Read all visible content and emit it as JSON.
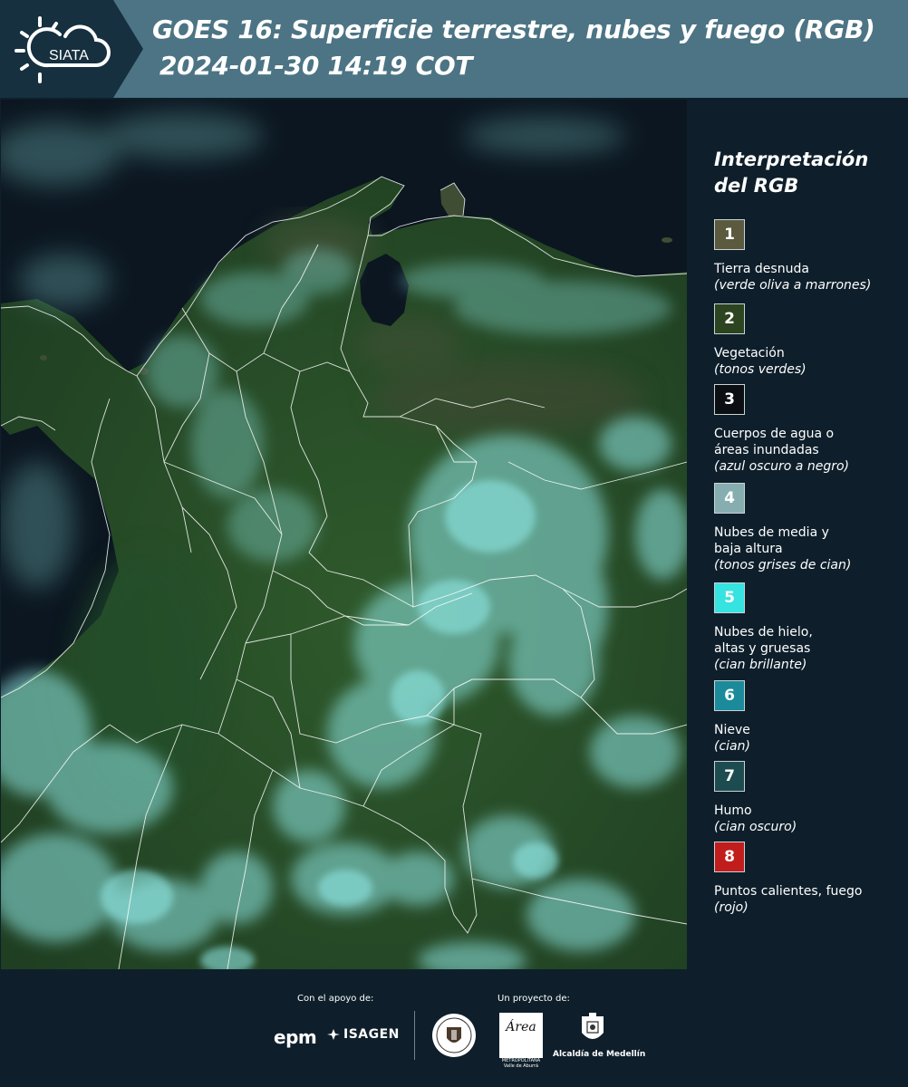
{
  "header": {
    "logo_text": "SIATA",
    "title_line1": "GOES 16: Superficie terrestre, nubes y fuego (RGB)",
    "title_line2": "2024-01-30 14:19 COT"
  },
  "legend": {
    "title": "Interpretación del RGB",
    "items": [
      {
        "number": "1",
        "name": "Tierra desnuda",
        "desc": "(verde oliva a marrones)",
        "color": "#5b5a3f",
        "text_color": "#ffffff"
      },
      {
        "number": "2",
        "name": "Vegetación",
        "desc": "(tonos verdes)",
        "color": "#2d4420",
        "text_color": "#ffffff"
      },
      {
        "number": "3",
        "name": "Cuerpos de agua o áreas inundadas",
        "desc": "(azul oscuro a negro)",
        "color": "#0b0f14",
        "text_color": "#ffffff"
      },
      {
        "number": "4",
        "name": "Nubes de media y baja altura",
        "desc": "(tonos grises de cian)",
        "color": "#86aeb1",
        "text_color": "#ffffff"
      },
      {
        "number": "5",
        "name": "Nubes de hielo, altas y gruesas",
        "desc": "(cian brillante)",
        "color": "#35e3e0",
        "text_color": "#ffffff"
      },
      {
        "number": "6",
        "name": "Nieve",
        "desc": "(cian)",
        "color": "#1b8a9a",
        "text_color": "#ffffff"
      },
      {
        "number": "7",
        "name": "Humo",
        "desc": "(cian oscuro)",
        "color": "#1d4c50",
        "text_color": "#ffffff"
      },
      {
        "number": "8",
        "name": "Puntos calientes, fuego",
        "desc": "(rojo)",
        "color": "#c21d1d",
        "text_color": "#ffffff"
      }
    ]
  },
  "footer": {
    "support_label": "Con el apoyo de:",
    "project_label": "Un proyecto de:",
    "epm_logo": "epm",
    "isagen_logo": "ISAGEN",
    "area_logo": "Área",
    "area_logo_sub": "METROPOLITANA Valle de Aburrá",
    "medellin_label": "Alcaldía de Medellín"
  }
}
